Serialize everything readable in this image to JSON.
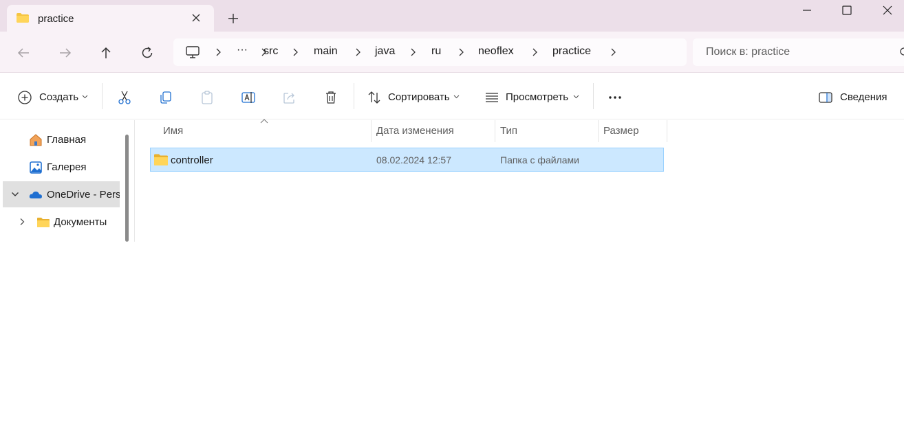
{
  "window": {
    "tab_title": "practice"
  },
  "breadcrumb": {
    "overflow": "···",
    "items": [
      "src",
      "main",
      "java",
      "ru",
      "neoflex",
      "practice"
    ]
  },
  "search": {
    "placeholder": "Поиск в: practice"
  },
  "toolbar": {
    "new_label": "Создать",
    "sort_label": "Сортировать",
    "view_label": "Просмотреть",
    "details_label": "Сведения"
  },
  "nav": {
    "items": [
      {
        "label": "Главная",
        "icon": "home-icon"
      },
      {
        "label": "Галерея",
        "icon": "gallery-icon"
      },
      {
        "label": "OneDrive - Perso",
        "icon": "onedrive-cloud-icon"
      },
      {
        "label": "Документы",
        "icon": "folder-icon"
      }
    ]
  },
  "columns": {
    "name": "Имя",
    "date": "Дата изменения",
    "type": "Тип",
    "size": "Размер"
  },
  "files": [
    {
      "name": "controller",
      "date": "08.02.2024 12:57",
      "type": "Папка с файлами",
      "size": ""
    }
  ],
  "colors": {
    "titlebar": "#ecdfe9",
    "tab": "#f9f2f7",
    "selection": "#cce8ff",
    "selection_border": "#99d1ff",
    "folder": "#f5c542",
    "accent_blue": "#1f6fd1"
  }
}
